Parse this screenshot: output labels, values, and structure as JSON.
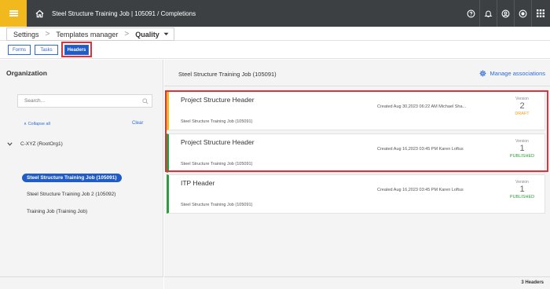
{
  "topbar": {
    "title": "Steel Structure Training Job | 105091  /  Completions",
    "icons": [
      "menu-icon",
      "home-icon",
      "help-icon",
      "bell-icon",
      "account-icon",
      "toggle-icon",
      "apps-grid-icon"
    ],
    "accent": "#f2b91e"
  },
  "breadcrumb": {
    "items": [
      "Settings",
      "Templates manager",
      "Quality"
    ],
    "separator": ">"
  },
  "tabs": {
    "items": [
      "Forms",
      "Tasks",
      "Headers"
    ],
    "active": "Headers"
  },
  "organization": {
    "title": "Organization",
    "search_placeholder": "Search...",
    "collapse_all": "Collapse all",
    "collapse_marker": "∧",
    "clear": "Clear",
    "root": "C-XYZ (RootOrg1)",
    "items": [
      "Steel Structure Training Job (105091)",
      "Steel Structure Training Job 2 (105092)",
      "Training Job (Training Job)"
    ],
    "selected": "Steel Structure Training Job (105091)"
  },
  "main": {
    "title": "Steel Structure Training Job (105091)",
    "manage_label": "Manage associations",
    "version_label": "Version",
    "cards": [
      {
        "title": "Project Structure Header",
        "subtitle": "Steel Structure Training Job (105091)",
        "meta": "Created Aug 30,2023 06:22 AM Michael Sha...",
        "version": "2",
        "status": "DRAFT"
      },
      {
        "title": "Project Structure Header",
        "subtitle": "Steel Structure Training Job (105091)",
        "meta": "Created Aug 16,2023 03:45 PM Karen Loftus",
        "version": "1",
        "status": "PUBLISHED"
      },
      {
        "title": "ITP Header",
        "subtitle": "Steel Structure Training Job (105091)",
        "meta": "Created Aug 16,2023 03:45 PM Karen Loftus",
        "version": "1",
        "status": "PUBLISHED"
      }
    ],
    "count_label": "3 Headers"
  },
  "colors": {
    "topbar_bg": "#3d4043",
    "primary": "#1f5cc9",
    "draft": "#f2b91e",
    "published": "#2a9e3a",
    "highlight": "#e0323c"
  }
}
